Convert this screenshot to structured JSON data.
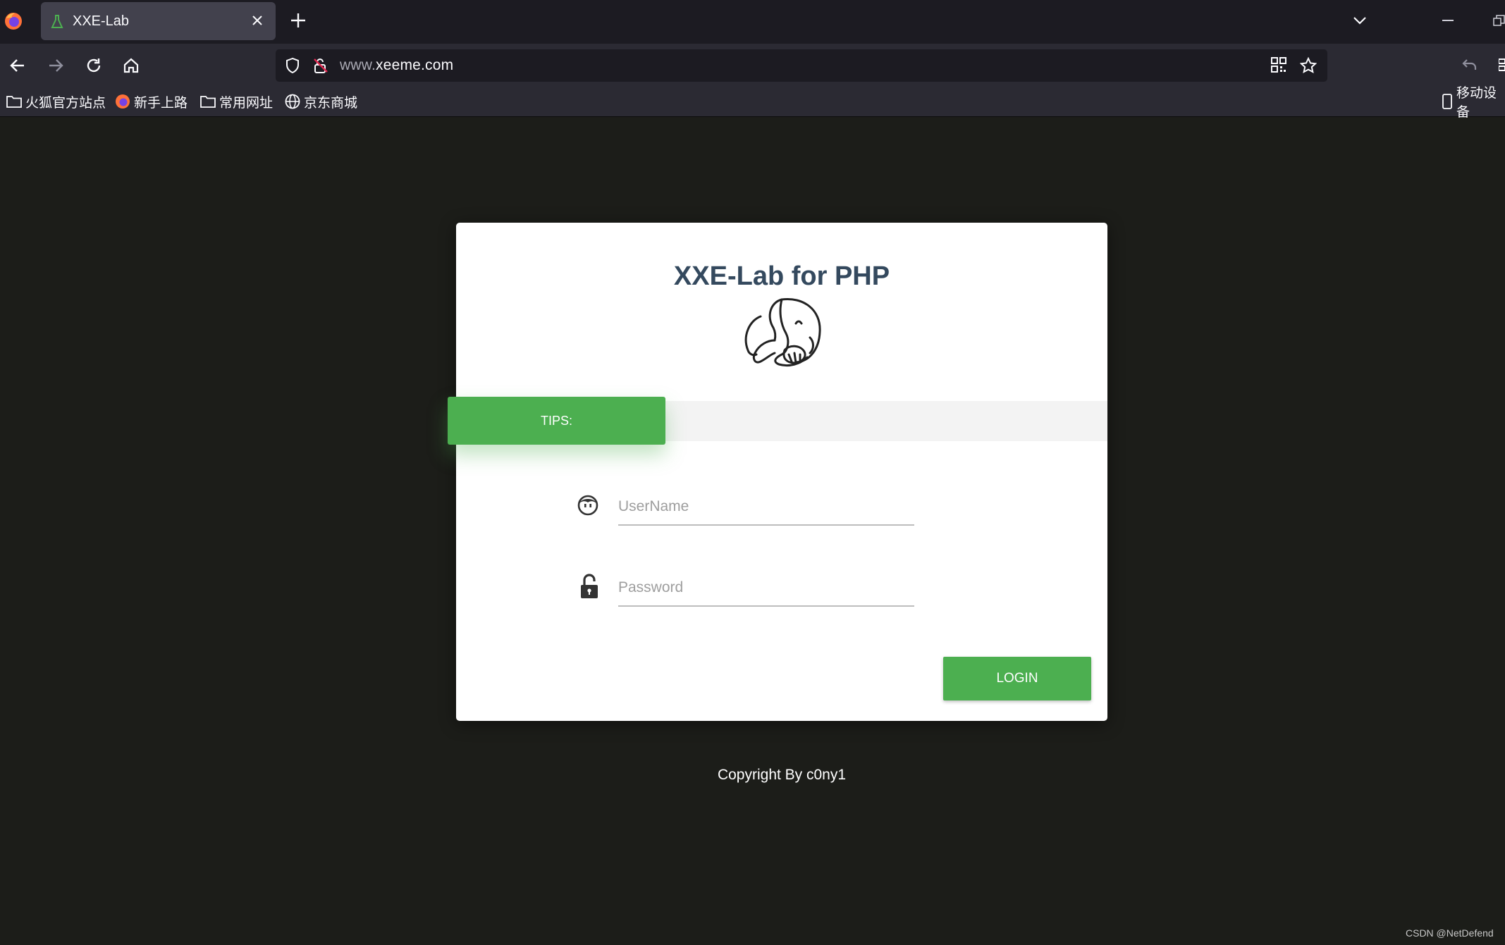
{
  "browser": {
    "tab_title": "XXE-Lab",
    "url_prefix": "www.",
    "url_domain": "xeeme.com",
    "bookmarks": [
      {
        "label": "火狐官方站点",
        "icon": "folder-icon"
      },
      {
        "label": "新手上路",
        "icon": "firefox-icon"
      },
      {
        "label": "常用网址",
        "icon": "folder-icon"
      },
      {
        "label": "京东商城",
        "icon": "globe-icon"
      }
    ],
    "mobile_bookmarks": "移动设备"
  },
  "page": {
    "title": "XXE-Lab for PHP",
    "tips_label": "TIPS:",
    "username_placeholder": "UserName",
    "password_placeholder": "Password",
    "login_label": "LOGIN",
    "copyright": "Copyright By c0ny1"
  },
  "watermark": "CSDN @NetDefend",
  "colors": {
    "accent_green": "#4caf50",
    "title_color": "#34495e",
    "page_background": "#1c1d19"
  }
}
